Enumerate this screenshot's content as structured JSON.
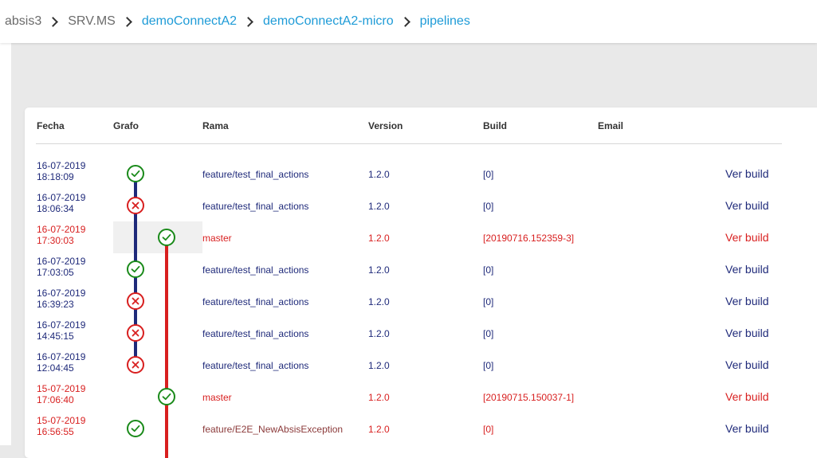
{
  "breadcrumb": [
    {
      "label": "absis3",
      "link": false
    },
    {
      "label": "SRV.MS",
      "link": false
    },
    {
      "label": "demoConnectA2",
      "link": true
    },
    {
      "label": "demoConnectA2-micro",
      "link": true
    },
    {
      "label": "pipelines",
      "link": true
    }
  ],
  "table": {
    "headers": {
      "fecha": "Fecha",
      "grafo": "Grafo",
      "rama": "Rama",
      "version": "Version",
      "build": "Build",
      "email": "Email"
    },
    "rows": [
      {
        "date": "16-07-2019",
        "time": "18:18:09",
        "rama": "feature/test_final_actions",
        "version": "1.2.0",
        "build": "[0]",
        "action": "Ver build",
        "status": "success",
        "master": false
      },
      {
        "date": "16-07-2019",
        "time": "18:06:34",
        "rama": "feature/test_final_actions",
        "version": "1.2.0",
        "build": "[0]",
        "action": "Ver build",
        "status": "failure",
        "master": false
      },
      {
        "date": "16-07-2019",
        "time": "17:30:03",
        "rama": "master",
        "version": "1.2.0",
        "build": "[20190716.152359-3]",
        "action": "Ver build",
        "status": "success",
        "master": true
      },
      {
        "date": "16-07-2019",
        "time": "17:03:05",
        "rama": "feature/test_final_actions",
        "version": "1.2.0",
        "build": "[0]",
        "action": "Ver build",
        "status": "success",
        "master": false
      },
      {
        "date": "16-07-2019",
        "time": "16:39:23",
        "rama": "feature/test_final_actions",
        "version": "1.2.0",
        "build": "[0]",
        "action": "Ver build",
        "status": "failure",
        "master": false
      },
      {
        "date": "16-07-2019",
        "time": "14:45:15",
        "rama": "feature/test_final_actions",
        "version": "1.2.0",
        "build": "[0]",
        "action": "Ver build",
        "status": "failure",
        "master": false
      },
      {
        "date": "16-07-2019",
        "time": "12:04:45",
        "rama": "feature/test_final_actions",
        "version": "1.2.0",
        "build": "[0]",
        "action": "Ver build",
        "status": "failure",
        "master": false
      },
      {
        "date": "15-07-2019",
        "time": "17:06:40",
        "rama": "master",
        "version": "1.2.0",
        "build": "[20190715.150037-1]",
        "action": "Ver build",
        "status": "success",
        "master": true
      },
      {
        "date": "15-07-2019",
        "time": "16:56:55",
        "rama": "feature/E2E_NewAbsisException",
        "version": "1.2.0",
        "build": "[0]",
        "action": "Ver build",
        "status": "success",
        "master": false,
        "partial_red": true
      }
    ]
  },
  "colors": {
    "feature_line": "#1f2a7a",
    "master_line": "#d81f1f",
    "success": "#1a8a1a",
    "failure": "#d81f1f",
    "link": "#1e9bd7"
  }
}
